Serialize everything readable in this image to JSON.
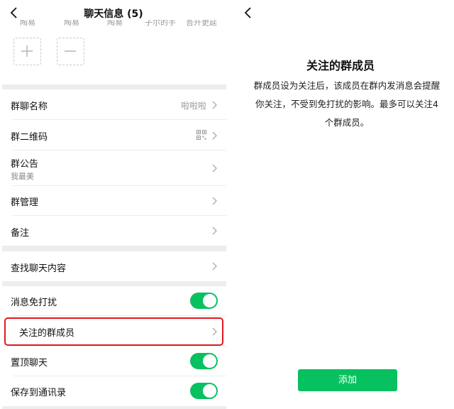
{
  "left": {
    "title": "聊天信息 (5)",
    "member_names": [
      "陶易",
      "陶易",
      "陶易",
      "子尔的手",
      "吾升更延"
    ],
    "rows": {
      "group_name": {
        "label": "群聊名称",
        "value": "啦啦啦"
      },
      "qr_code": {
        "label": "群二维码"
      },
      "notice": {
        "label": "群公告",
        "sub": "我最美"
      },
      "manage": {
        "label": "群管理"
      },
      "remark": {
        "label": "备注"
      },
      "search_history": {
        "label": "查找聊天内容"
      },
      "mute": {
        "label": "消息免打扰",
        "on": true
      },
      "followed_members": {
        "label": "关注的群成员"
      },
      "pin": {
        "label": "置顶聊天",
        "on": true
      },
      "save_contacts": {
        "label": "保存到通讯录",
        "on": true
      }
    }
  },
  "right": {
    "title": "关注的群成员",
    "description": "群成员设为关注后，该成员在群内发消息会提醒你关注，不受到免打扰的影响。最多可以关注4个群成员。",
    "add_button": "添加"
  },
  "colors": {
    "accent_green": "#07c160",
    "highlight_red": "#e1191d",
    "separator_gray": "#ededed"
  },
  "icons": [
    "back-chevron-icon",
    "plus-icon",
    "minus-icon",
    "qr-code-icon",
    "chevron-right-icon"
  ]
}
